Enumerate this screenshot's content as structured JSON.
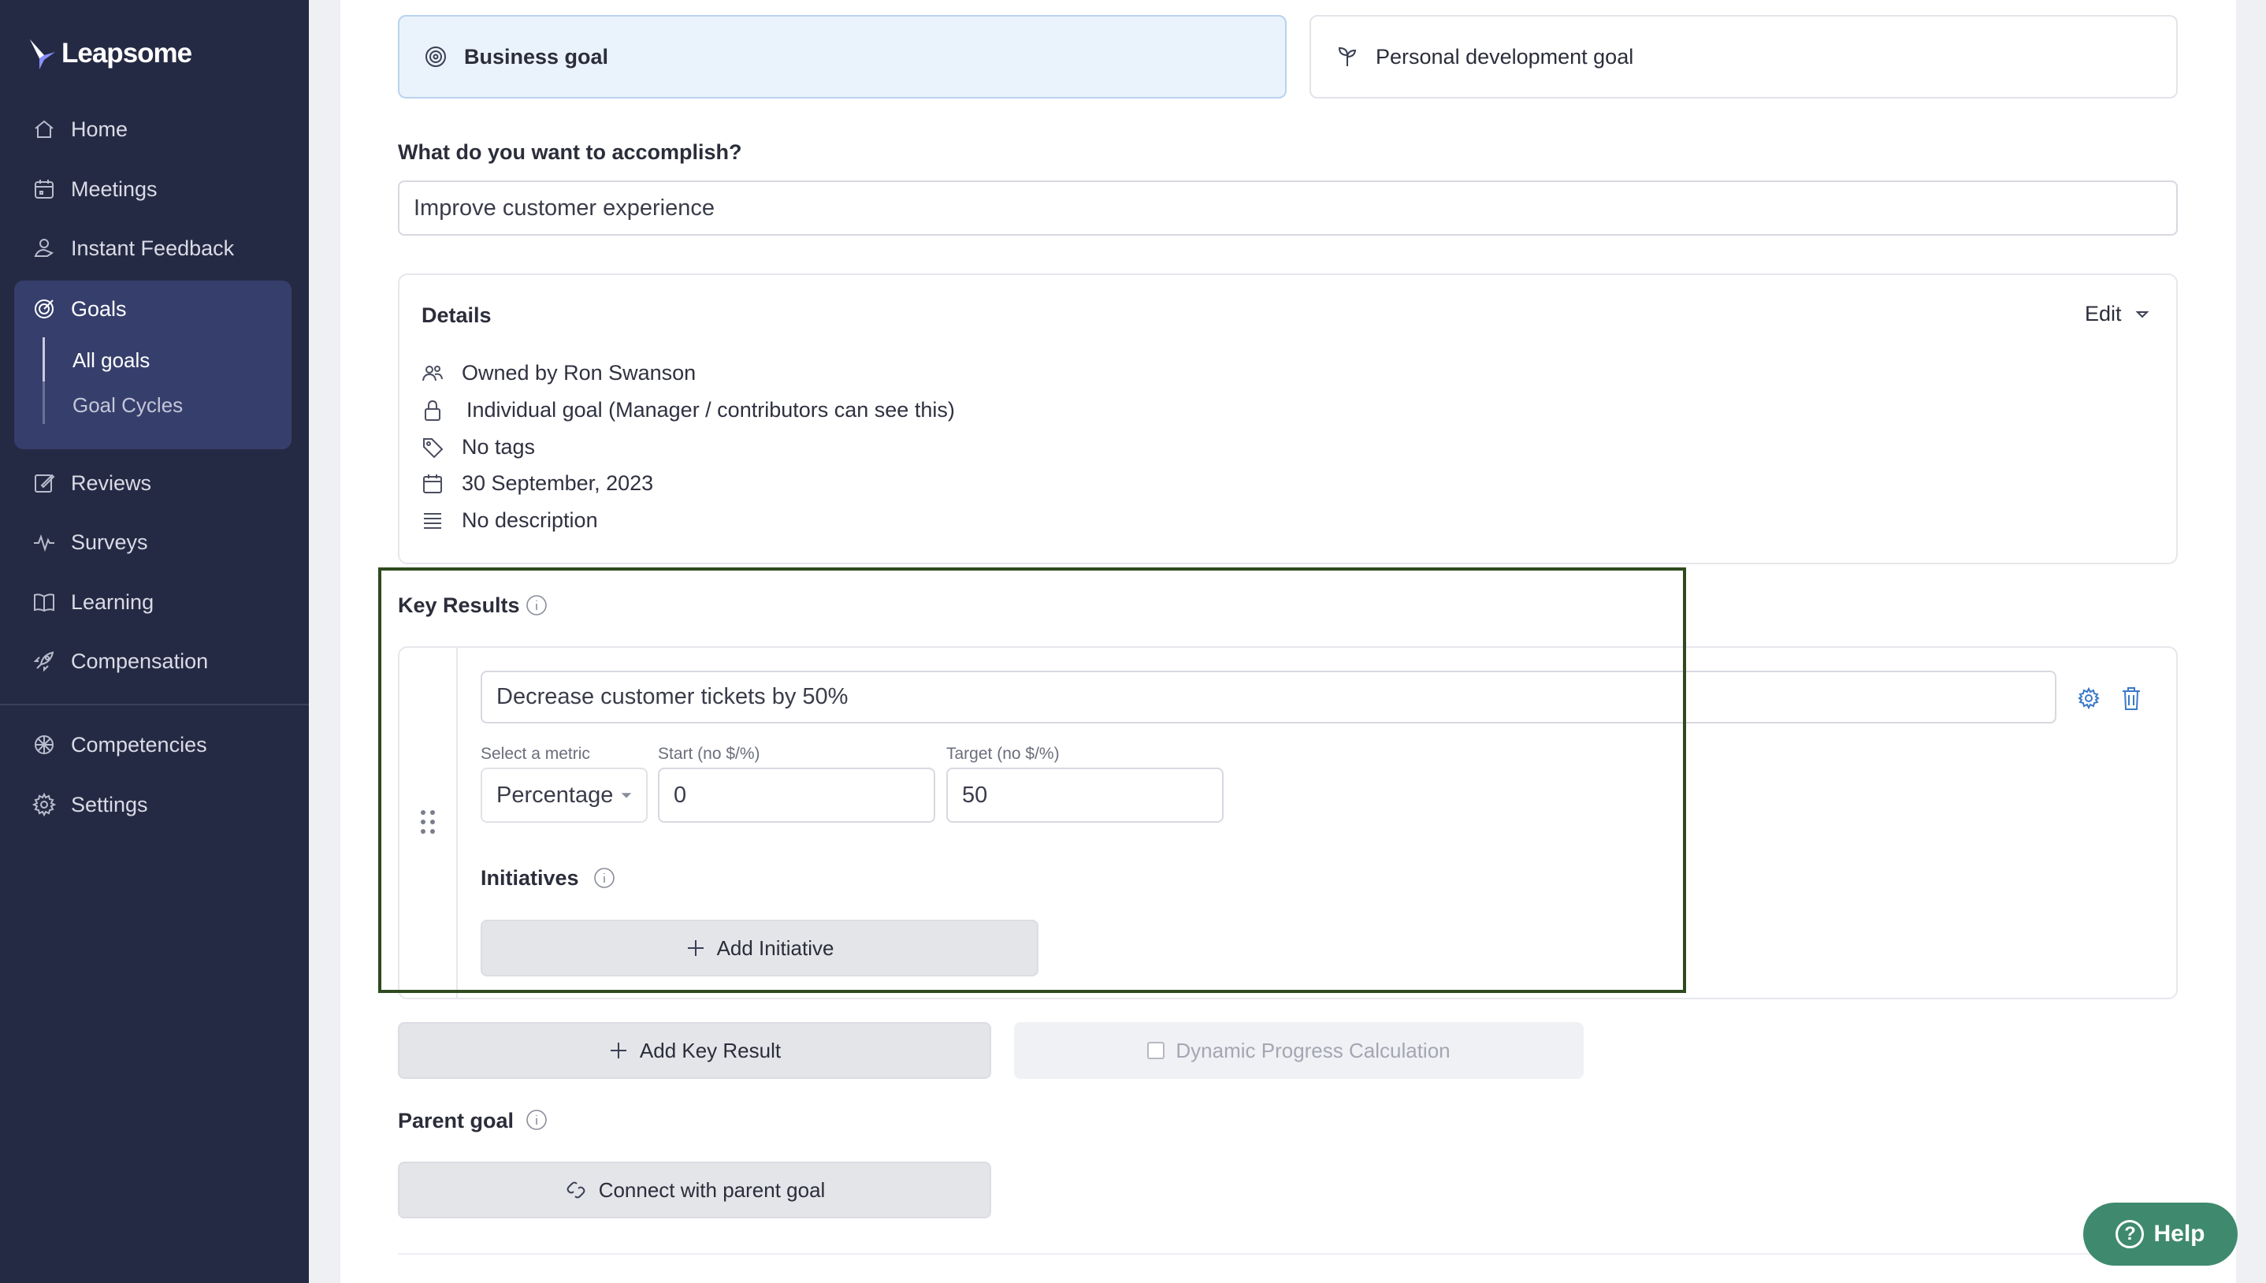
{
  "app": {
    "brand": "Leapsome"
  },
  "sidebar": {
    "items": [
      {
        "label": "Home",
        "icon": "home-icon"
      },
      {
        "label": "Meetings",
        "icon": "calendar-icon"
      },
      {
        "label": "Instant Feedback",
        "icon": "feedback-icon"
      },
      {
        "label": "Goals",
        "icon": "target-icon"
      },
      {
        "label": "Reviews",
        "icon": "edit-icon"
      },
      {
        "label": "Surveys",
        "icon": "pulse-icon"
      },
      {
        "label": "Learning",
        "icon": "book-icon"
      },
      {
        "label": "Compensation",
        "icon": "rocket-icon"
      },
      {
        "label": "Competencies",
        "icon": "compass-icon"
      },
      {
        "label": "Settings",
        "icon": "gear-icon"
      }
    ],
    "goals_sub": [
      {
        "label": "All goals",
        "active": true
      },
      {
        "label": "Goal Cycles",
        "active": false
      }
    ]
  },
  "goal_types": {
    "business": "Business goal",
    "personal": "Personal development goal"
  },
  "accomplish": {
    "label": "What do you want to accomplish?",
    "value": "Improve customer experience"
  },
  "details": {
    "title": "Details",
    "edit": "Edit",
    "owner": "Owned by Ron Swanson",
    "visibility": "Individual goal (Manager / contributors can see this)",
    "tags": "No tags",
    "date": "30 September, 2023",
    "description": "No description"
  },
  "key_results": {
    "title": "Key Results",
    "items": [
      {
        "name": "Decrease customer tickets by 50%",
        "metric_label": "Select a metric",
        "metric": "Percentage",
        "start_label": "Start (no $/%)",
        "start": "0",
        "target_label": "Target (no $/%)",
        "target": "50",
        "initiatives_label": "Initiatives",
        "add_initiative": "Add Initiative"
      }
    ],
    "add_key_result": "Add Key Result",
    "dynamic_progress": "Dynamic Progress Calculation"
  },
  "parent_goal": {
    "title": "Parent goal",
    "connect": "Connect with parent goal"
  },
  "help": {
    "label": "Help"
  },
  "colors": {
    "sidebar_bg": "#252a44",
    "goals_active_bg": "#363f6c",
    "business_selected_bg": "#eaf2fc",
    "highlight_border": "#2f4a1f",
    "help_bg": "#3f8a6e"
  }
}
